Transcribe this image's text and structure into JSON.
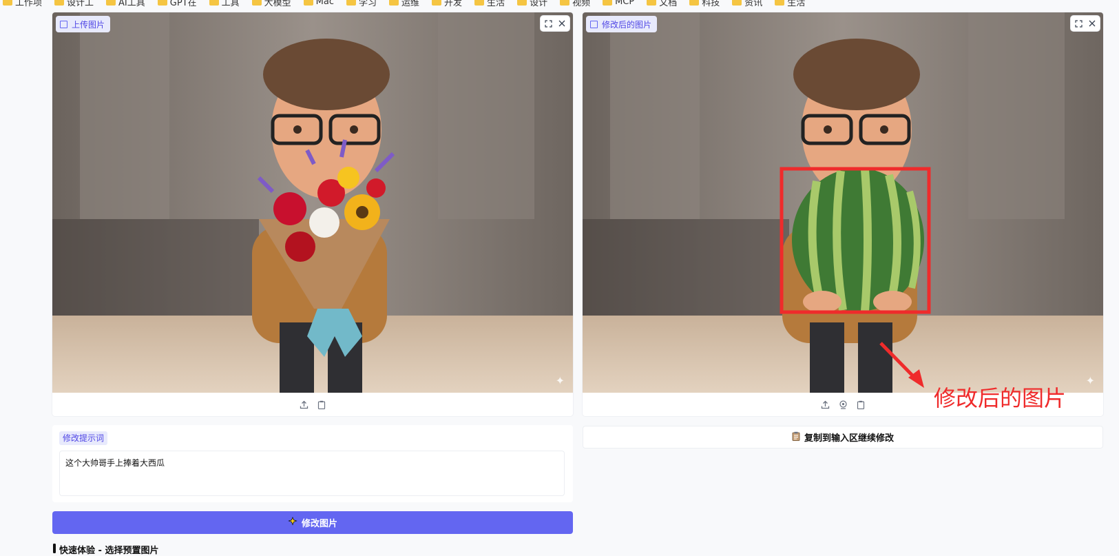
{
  "bookmarks": [
    "工作项",
    "设计工",
    "AI工具",
    "GPT在",
    "工具",
    "大模型",
    "Mac",
    "学习",
    "运维",
    "开发",
    "生活",
    "设计",
    "视频",
    "MCP",
    "文档",
    "科技",
    "资讯",
    "生活"
  ],
  "left_panel": {
    "label": "上传图片",
    "icons": [
      "fullscreen-icon",
      "close-icon",
      "upload-icon",
      "clipboard-icon"
    ]
  },
  "right_panel": {
    "label": "修改后的图片",
    "icons": [
      "fullscreen-icon",
      "close-icon",
      "upload-icon",
      "webcam-icon",
      "clipboard-icon"
    ]
  },
  "annotation": {
    "text": "修改后的图片",
    "color": "#ef2b2b"
  },
  "prompt": {
    "label": "修改提示词",
    "value": "这个大帅哥手上捧着大西瓜"
  },
  "actions": {
    "modify_label": "修改图片",
    "copy_label": "复制到输入区继续修改"
  },
  "quick": {
    "title": "快速体验 - 选择预置图片"
  },
  "colors": {
    "accent": "#6366f1",
    "chip_bg": "#e8eafc",
    "annotation": "#ef2b2b"
  }
}
